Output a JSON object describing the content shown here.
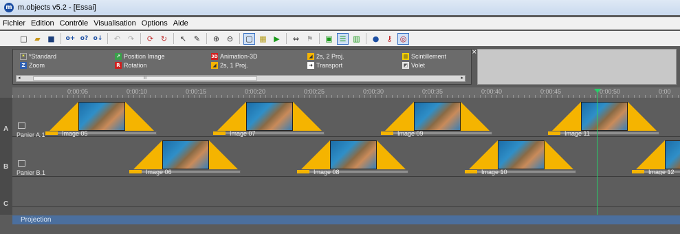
{
  "window": {
    "title": "m.objects v5.2 - [Essai]",
    "icon_letter": "m"
  },
  "menu": [
    "Fichier",
    "Edition",
    "Contrôle",
    "Visualisation",
    "Options",
    "Aide"
  ],
  "toolbar_icons": [
    "new-icon",
    "open-icon",
    "save-icon",
    "object-add-icon",
    "object-help-icon",
    "object-select-icon",
    "undo-icon",
    "redo-icon",
    "refresh-icon",
    "sync-icon",
    "cursor-icon",
    "wrench-icon",
    "zoom-in-icon",
    "zoom-out-icon",
    "frame-icon",
    "grid-icon",
    "play-icon",
    "loop-icon",
    "marker-icon",
    "screen-icon",
    "tracks-icon",
    "panel-icon",
    "record-icon",
    "key-icon",
    "loop-active-icon"
  ],
  "palette": {
    "items": [
      {
        "label": "*Standard",
        "icon": "standard-icon"
      },
      {
        "label": "Zoom",
        "icon": "zoom-icon"
      },
      {
        "label": "Position Image",
        "icon": "position-image-icon"
      },
      {
        "label": "Rotation",
        "icon": "rotation-icon"
      },
      {
        "label": "Animation-3D",
        "icon": "animation-3d-icon"
      },
      {
        "label": "2s, 1 Proj.",
        "icon": "fade-1proj-icon"
      },
      {
        "label": "2s, 2 Proj.",
        "icon": "fade-2proj-icon"
      },
      {
        "label": "Transport",
        "icon": "transport-icon"
      },
      {
        "label": "Scintillement",
        "icon": "scintillement-icon"
      },
      {
        "label": "Volet",
        "icon": "volet-icon"
      }
    ],
    "scroll_thumb_text": "III"
  },
  "ruler": {
    "ticks": [
      "0:00:05",
      "0:00:10",
      "0:00:15",
      "0:00:20",
      "0:00:25",
      "0:00:30",
      "0:00:35",
      "0:00:40",
      "0:00:45",
      "0:00:50",
      "0:00"
    ]
  },
  "tracks": [
    {
      "letter": "A",
      "label": "Panier A.1",
      "clips": [
        "Image 05",
        "Image 07",
        "Image 09",
        "Image 11"
      ]
    },
    {
      "letter": "B",
      "label": "Panier B.1",
      "clips": [
        "Image 06",
        "Image 08",
        "Image 10",
        "Image 12"
      ]
    },
    {
      "letter": "C",
      "label": "",
      "clips": []
    }
  ],
  "projection_label": "Projection",
  "colors": {
    "fade_ramp": "#f5b400",
    "playhead": "#26d06a",
    "timeline_bg": "#5d5d5d"
  }
}
